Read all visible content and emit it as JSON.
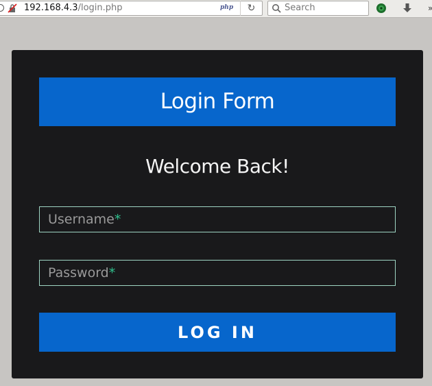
{
  "browser": {
    "url_host": "192.168.4.3",
    "url_path": "/login.php",
    "php_badge": "php",
    "reload_glyph": "↻",
    "search_placeholder": "Search",
    "icons": [
      "info-icon",
      "insecure-connection-icon",
      "reload-icon",
      "search-icon",
      "addon-icon",
      "download-icon",
      "overflow-icon"
    ],
    "overflow_glyph": "»"
  },
  "login": {
    "title": "Login Form",
    "welcome": "Welcome Back!",
    "username_placeholder": "Username",
    "password_placeholder": "Password",
    "required_marker": "*",
    "submit_label": "LOG IN"
  },
  "colors": {
    "panel_bg": "#19191b",
    "accent_blue": "#0766cc",
    "field_border": "#9fd6c4",
    "required_green": "#2fc08d",
    "page_bg": "#c7c5c2"
  }
}
